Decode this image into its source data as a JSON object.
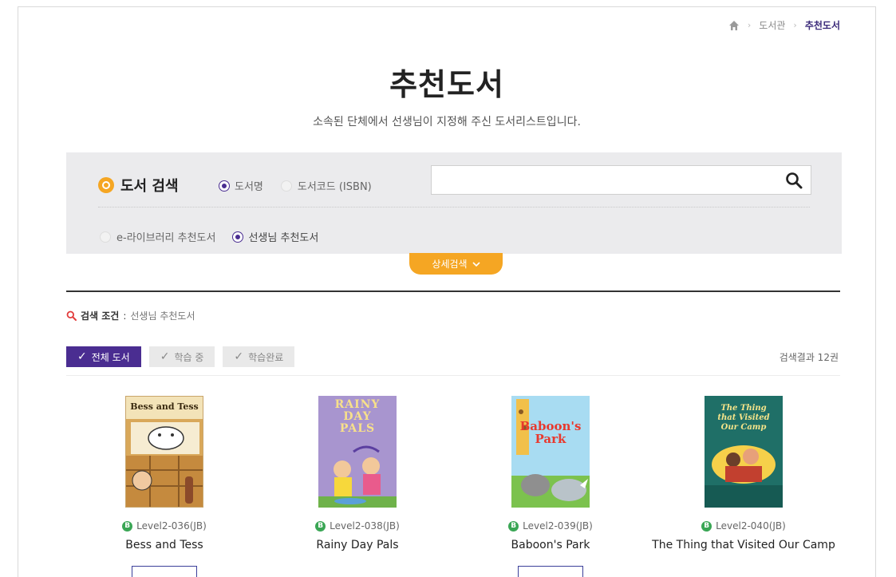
{
  "breadcrumb": {
    "items": [
      "도서관",
      "추천도서"
    ],
    "separator": "›"
  },
  "page": {
    "title": "추천도서",
    "subtitle": "소속된 단체에서 선생님이 지정해 주신 도서리스트입니다."
  },
  "search": {
    "heading": "도서 검색",
    "type_options": [
      {
        "label": "도서명",
        "selected": true
      },
      {
        "label": "도서코드 (ISBN)",
        "selected": false
      }
    ],
    "input_value": "",
    "source_options": [
      {
        "label": "e-라이브러리 추천도서",
        "selected": false
      },
      {
        "label": "선생님 추천도서",
        "selected": true
      }
    ],
    "detail_label": "상세검색"
  },
  "condition": {
    "label": "검색 조건",
    "value": "선생님 추천도서"
  },
  "filters": [
    {
      "label": "전체 도서",
      "active": true
    },
    {
      "label": "학습 중",
      "active": false
    },
    {
      "label": "학습완료",
      "active": false
    }
  ],
  "result_count": "검색결과 12권",
  "books": [
    {
      "code": "Level2-036(JB)",
      "title": "Bess and Tess",
      "badge": "B",
      "cover_text": "Bess and Tess"
    },
    {
      "code": "Level2-038(JB)",
      "title": "Rainy Day Pals",
      "badge": "B",
      "cover_text": "RAINY DAY PALS"
    },
    {
      "code": "Level2-039(JB)",
      "title": "Baboon's Park",
      "badge": "B",
      "cover_text": "Baboon's Park"
    },
    {
      "code": "Level2-040(JB)",
      "title": "The Thing that Visited Our Camp",
      "badge": "B",
      "cover_text": "The Thing that Visited Our Camp"
    }
  ],
  "colors": {
    "accent_purple": "#4a2d91",
    "accent_orange": "#f5a623",
    "level_green": "#3aa655"
  }
}
